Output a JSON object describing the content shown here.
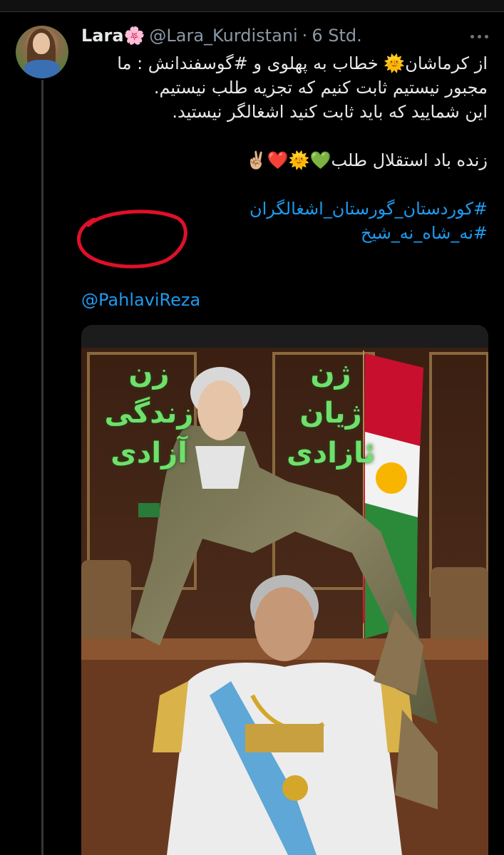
{
  "tweet": {
    "author_name": "Lara🌸",
    "handle": "@Lara_Kurdistani",
    "separator": "·",
    "time": "6 Std.",
    "text_lines": [
      "از کرماشان🌞 خطاب به پهلوی و #گوسفندانش : ما",
      "مجبور نیستیم ثابت کنیم که تجزیه طلب نیستیم.",
      "این شمایید که باید ثابت کنید اشغالگر نیستید."
    ],
    "slogan": "زنده باد استقلال طلب💚🌞❤️✌🏼",
    "hashtags": [
      "#کوردستان_گورستان_اشغالگران",
      "#نه_شاه_نه_شیخ"
    ],
    "mention": "@PahlaviReza"
  },
  "media": {
    "overlay_left_lines": [
      "ژن",
      "ژیان",
      "ئازادی"
    ],
    "overlay_right_lines": [
      "زن",
      "زندگی",
      "آزادی"
    ]
  },
  "colors": {
    "background": "#000000",
    "link": "#1d9bf0",
    "secondary_text": "#8b98a5",
    "annotation": "#e0102a",
    "overlay_text": "#6fe06a"
  },
  "icons": [
    "more-icon"
  ]
}
